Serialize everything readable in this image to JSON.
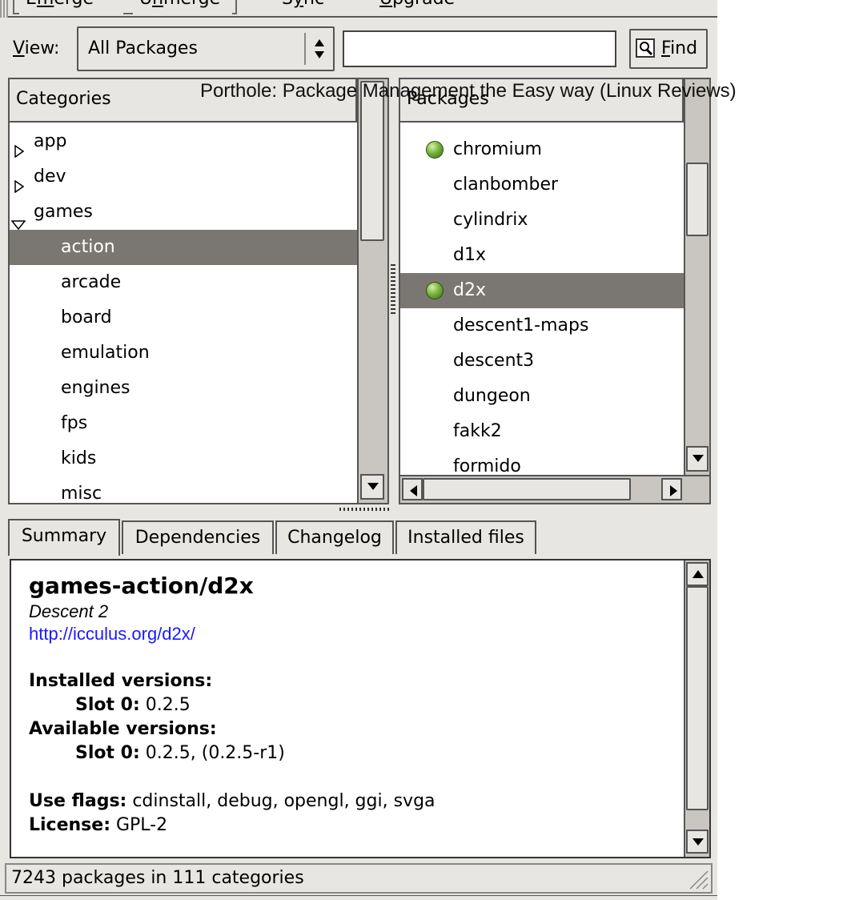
{
  "toolbar": {
    "emerge": {
      "pre": "E",
      "mn": "m",
      "post": "erge"
    },
    "unmerge": {
      "pre": "U",
      "mn": "n",
      "post": "merge"
    },
    "sync": {
      "pre": "S",
      "mn": "y",
      "post": "nc"
    },
    "upgrade": {
      "pre": "",
      "mn": "U",
      "post": "pgrade"
    }
  },
  "view": {
    "label_mn": "V",
    "label_rest": "iew:",
    "selected": "All Packages",
    "search_value": "",
    "find_mn": "F",
    "find_rest": "ind"
  },
  "caption": "Porthole: Package Management the Easy way (Linux Reviews)",
  "categories": {
    "header": "Categories",
    "items": [
      {
        "label": "app",
        "expander": "collapsed",
        "level": 0
      },
      {
        "label": "dev",
        "expander": "collapsed",
        "level": 0
      },
      {
        "label": "games",
        "expander": "expanded",
        "level": 0
      },
      {
        "label": "action",
        "level": 1,
        "selected": true
      },
      {
        "label": "arcade",
        "level": 1
      },
      {
        "label": "board",
        "level": 1
      },
      {
        "label": "emulation",
        "level": 1
      },
      {
        "label": "engines",
        "level": 1
      },
      {
        "label": "fps",
        "level": 1
      },
      {
        "label": "kids",
        "level": 1
      },
      {
        "label": "misc",
        "level": 1
      }
    ]
  },
  "packages": {
    "header": "Packages",
    "items": [
      {
        "label": "chromium",
        "installed": true
      },
      {
        "label": "clanbomber",
        "installed": false
      },
      {
        "label": "cylindrix",
        "installed": false
      },
      {
        "label": "d1x",
        "installed": false
      },
      {
        "label": "d2x",
        "installed": true,
        "selected": true
      },
      {
        "label": "descent1-maps",
        "installed": false
      },
      {
        "label": "descent3",
        "installed": false
      },
      {
        "label": "dungeon",
        "installed": false
      },
      {
        "label": "fakk2",
        "installed": false
      },
      {
        "label": "formido",
        "installed": false
      }
    ]
  },
  "tabs": [
    "Summary",
    "Dependencies",
    "Changelog",
    "Installed files"
  ],
  "summary": {
    "name": "games-action/d2x",
    "description": "Descent 2",
    "url": "http://icculus.org/d2x/",
    "installed_label": "Installed versions:",
    "installed_slot_label": "Slot 0:",
    "installed_slot_value": " 0.2.5",
    "available_label": "Available versions:",
    "available_slot_label": "Slot 0:",
    "available_slot_value": " 0.2.5, (0.2.5-r1)",
    "use_flags_label": "Use flags:",
    "use_flags_value": " cdinstall, debug, opengl, ggi, svga",
    "license_label": "License:",
    "license_value": " GPL-2"
  },
  "status": "7243 packages in 111 categories",
  "colors": {
    "selection": "#7a7772",
    "chrome": "#e8e6e3",
    "link": "#1a1aff"
  }
}
